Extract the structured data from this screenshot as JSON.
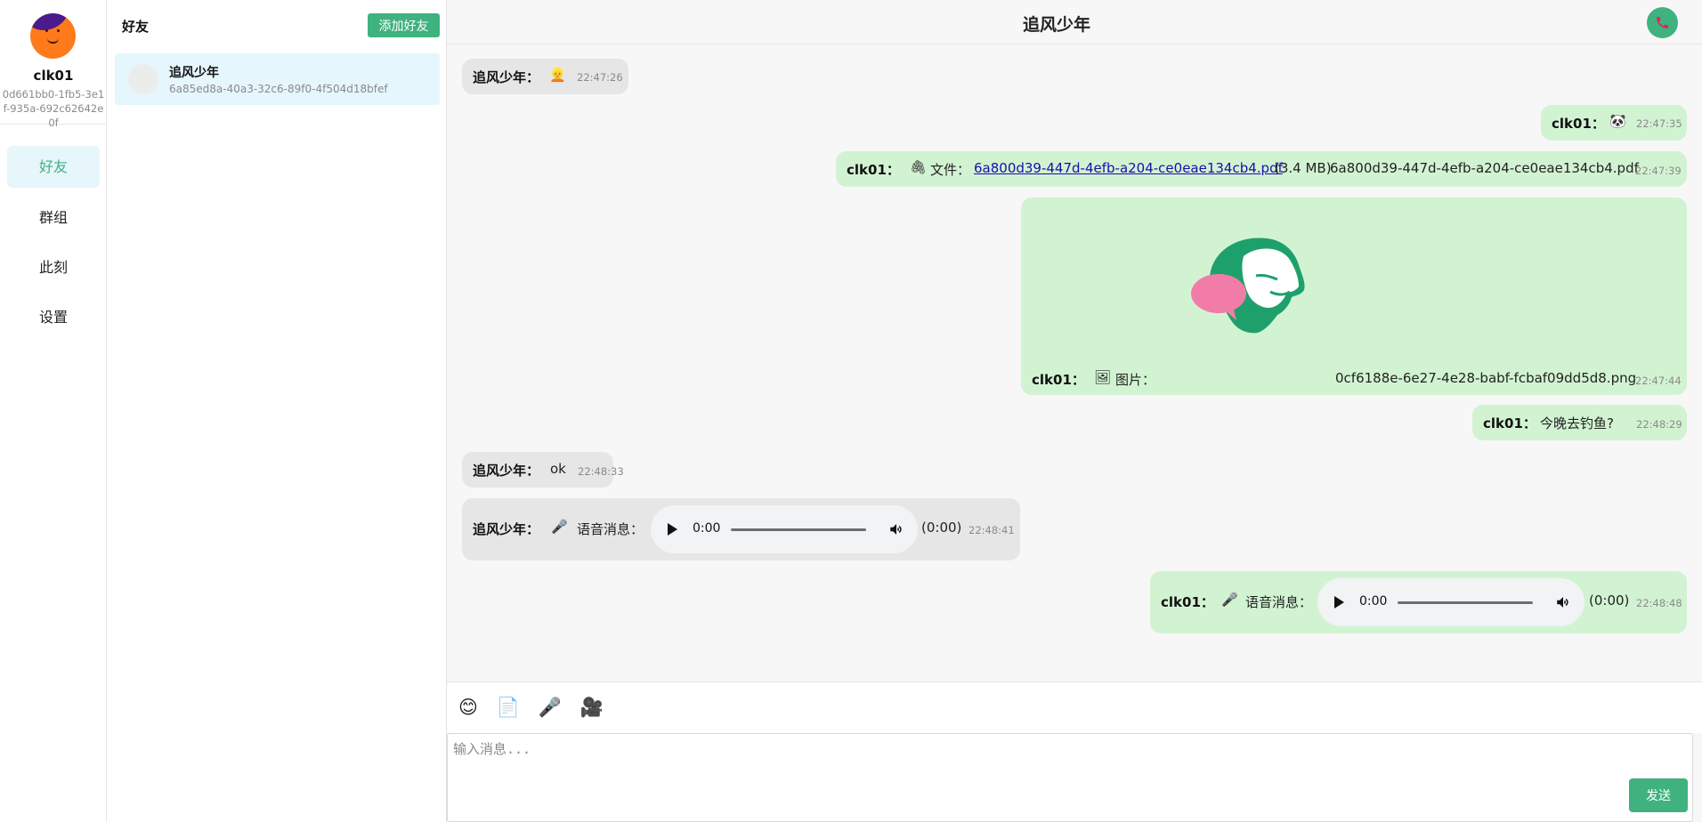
{
  "user": {
    "name": "clk01",
    "id": "0d661bb0-1fb5-3e1f-935a-692c62642e0f"
  },
  "nav": {
    "items": [
      {
        "label": "好友"
      },
      {
        "label": "群组"
      },
      {
        "label": "此刻"
      },
      {
        "label": "设置"
      }
    ]
  },
  "friends": {
    "title": "好友",
    "add_label": "添加好友",
    "items": [
      {
        "name": "追风少年",
        "id": "6a85ed8a-40a3-32c6-89f0-4f504d18bfef"
      }
    ]
  },
  "chat": {
    "title": "追风少年",
    "messages": [
      {
        "sender": "追风少年：",
        "content": "👱",
        "time": "22:47:26"
      },
      {
        "sender": "clk01：",
        "content": "🐼",
        "time": "22:47:35"
      },
      {
        "sender": "clk01：",
        "icon": "🖇",
        "prefix": "文件：",
        "link": "6a800d39-447d-4efb-a204-ce0eae134cb4.pdf",
        "size": "(3.4 MB)",
        "filename": "6a800d39-447d-4efb-a204-ce0eae134cb4.pdf",
        "time": "22:47:39"
      },
      {
        "sender": "clk01：",
        "icon": "🖼",
        "prefix": "图片：",
        "filename": "0cf6188e-6e27-4e28-babf-fcbaf09dd5d8.png",
        "time": "22:47:44"
      },
      {
        "sender": "clk01：",
        "content": "今晚去钓鱼?",
        "time": "22:48:29"
      },
      {
        "sender": "追风少年：",
        "content": "ok",
        "time": "22:48:33"
      },
      {
        "sender": "追风少年：",
        "icon": "🎤",
        "prefix": "语音消息：",
        "player_time": "0:00",
        "duration": "(0:00)",
        "time": "22:48:41"
      },
      {
        "sender": "clk01：",
        "icon": "🎤",
        "prefix": "语音消息：",
        "player_time": "0:00",
        "duration": "(0:00)",
        "time": "22:48:48"
      }
    ]
  },
  "composer": {
    "tools": [
      "😊",
      "📄",
      "🎤",
      "🎥"
    ],
    "placeholder": "输入消息...",
    "send_label": "发送"
  },
  "colors": {
    "accent": "#3fb27f",
    "incoming_bubble": "#e6e6e6",
    "outgoing_bubble": "#d2f3d2",
    "active_nav_bg": "#e6f6fb"
  }
}
